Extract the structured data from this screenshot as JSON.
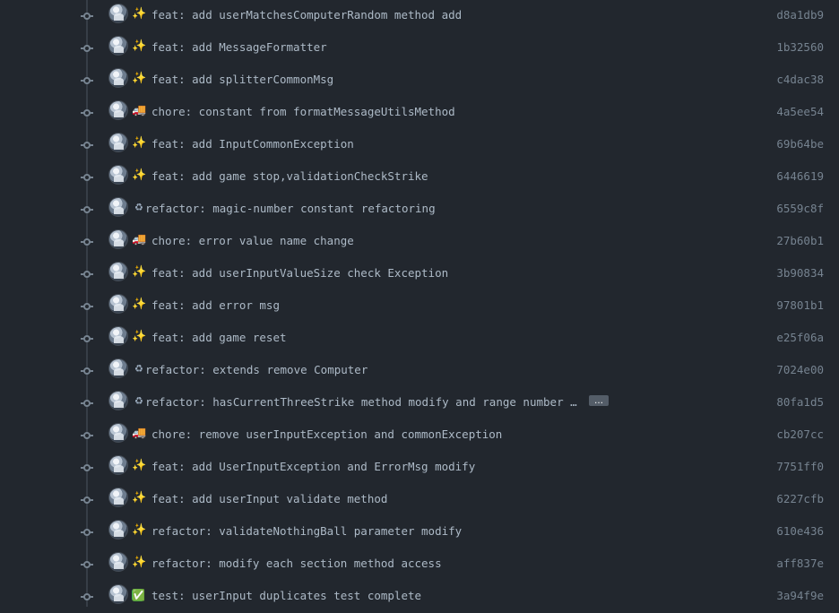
{
  "commits": [
    {
      "emoji": "✨",
      "message": "feat: add userMatchesComputerRandom method add",
      "sha": "d8a1db9"
    },
    {
      "emoji": "✨",
      "message": "feat: add MessageFormatter",
      "sha": "1b32560"
    },
    {
      "emoji": "✨",
      "message": "feat: add splitterCommonMsg",
      "sha": "c4dac38"
    },
    {
      "emoji": "🚚",
      "message": "chore: constant from formatMessageUtilsMethod",
      "sha": "4a5ee54"
    },
    {
      "emoji": "✨",
      "message": "feat: add InputCommonException",
      "sha": "69b64be"
    },
    {
      "emoji": "✨",
      "message": "feat: add game stop,validationCheckStrike",
      "sha": "6446619"
    },
    {
      "emoji": "♻",
      "message": "refactor: magic-number constant refactoring",
      "sha": "6559c8f"
    },
    {
      "emoji": "🚚",
      "message": "chore: error value name change",
      "sha": "27b60b1"
    },
    {
      "emoji": "✨",
      "message": "feat: add userInputValueSize check Exception",
      "sha": "3b90834"
    },
    {
      "emoji": "✨",
      "message": "feat: add error msg",
      "sha": "97801b1"
    },
    {
      "emoji": "✨",
      "message": "feat: add game reset",
      "sha": "e25f06a"
    },
    {
      "emoji": "♻",
      "message": "refactor: extends remove Computer",
      "sha": "7024e00"
    },
    {
      "emoji": "♻",
      "message": "refactor: hasCurrentThreeStrike method modify and range number con…",
      "sha": "80fa1d5",
      "more_label": "…"
    },
    {
      "emoji": "🚚",
      "message": "chore: remove userInputException and commonException",
      "sha": "cb207cc"
    },
    {
      "emoji": "✨",
      "message": "feat: add UserInputException and ErrorMsg modify",
      "sha": "7751ff0"
    },
    {
      "emoji": "✨",
      "message": "feat: add userInput validate method",
      "sha": "6227cfb"
    },
    {
      "emoji": "✨",
      "message": "refactor: validateNothingBall parameter modify",
      "sha": "610e436"
    },
    {
      "emoji": "✨",
      "message": "refactor: modify each section method access",
      "sha": "aff837e"
    },
    {
      "emoji": "✅",
      "message": "test: userInput duplicates test complete",
      "sha": "3a94f9e"
    }
  ]
}
